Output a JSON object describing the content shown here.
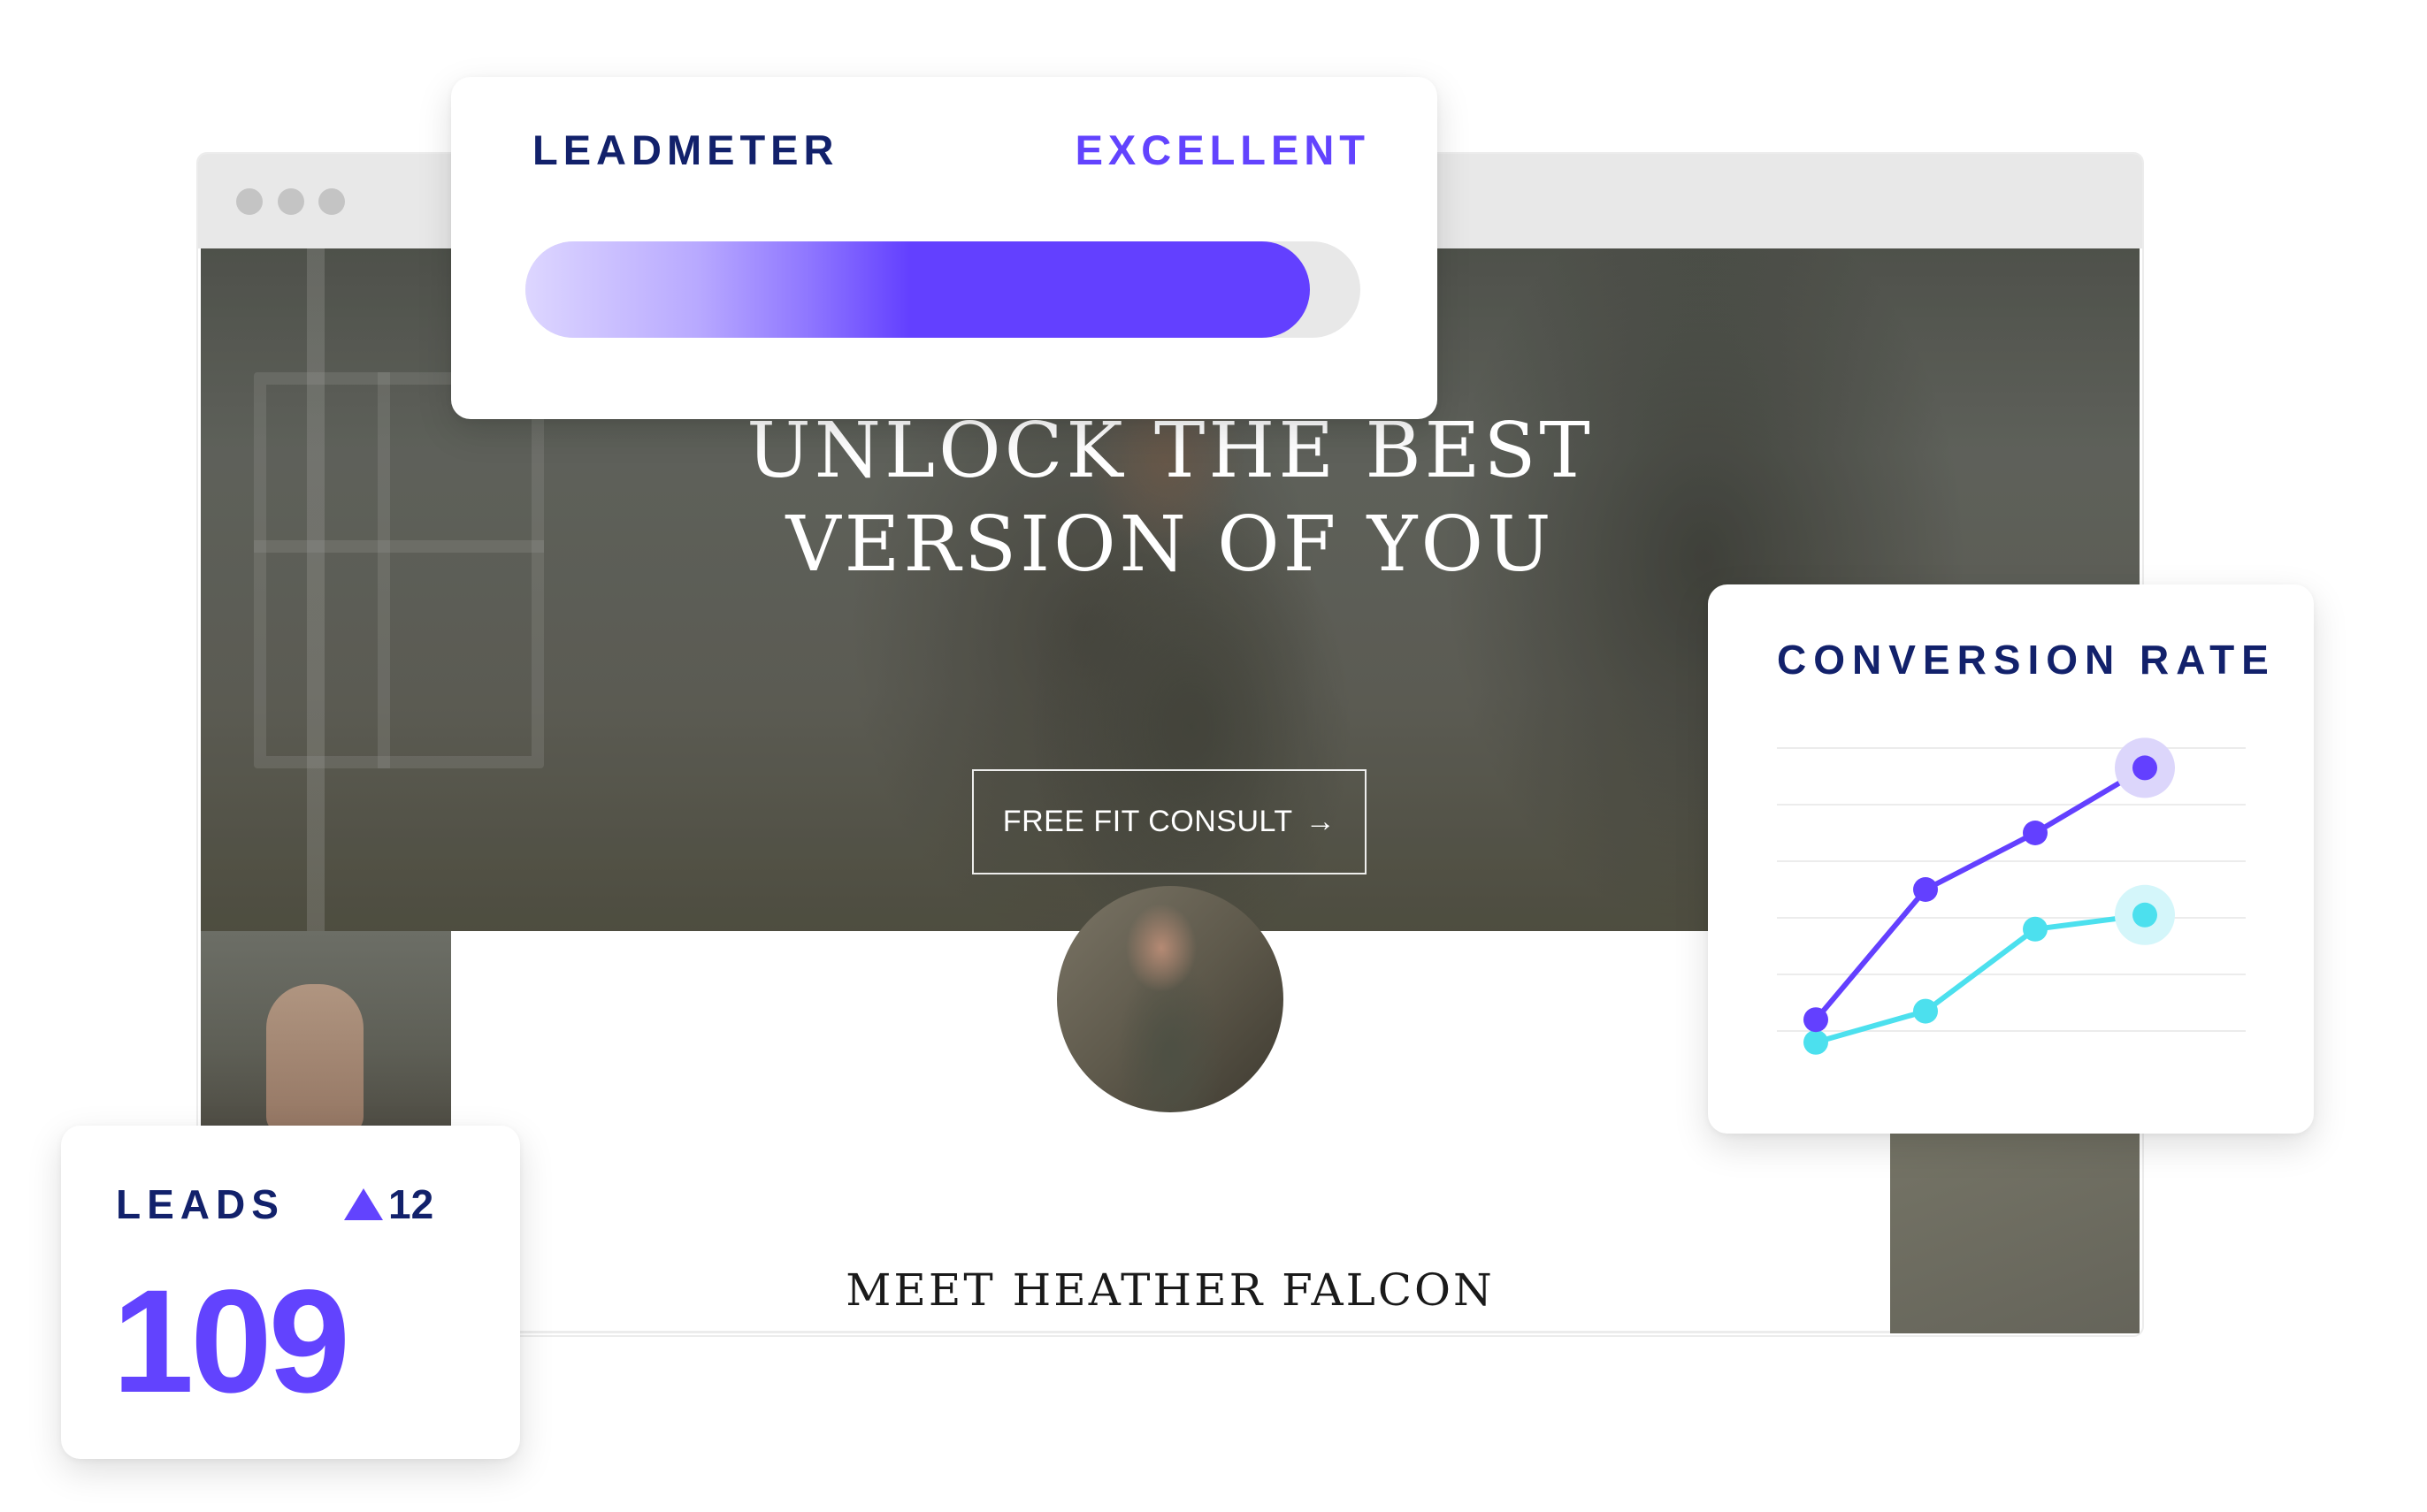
{
  "browser": {
    "window_controls": [
      "dot",
      "dot",
      "dot"
    ]
  },
  "hero": {
    "headline_line1": "UNLOCK THE BEST",
    "headline_line2": "VERSION OF YOU",
    "cta_label": "FREE FIT CONSULT",
    "cta_icon": "arrow-right-icon",
    "cta_arrow": "→"
  },
  "profile": {
    "avatar": "avatar-photo",
    "heading": "MEET HEATHER FALCON"
  },
  "leadmeter": {
    "title": "LEADMETER",
    "status": "EXCELLENT",
    "progress_percent": 94,
    "colors": {
      "accent": "#6340ff",
      "track": "#e8e8e8",
      "title": "#12216b"
    }
  },
  "leads": {
    "label": "LEADS",
    "delta_icon": "triangle-up-icon",
    "delta": "12",
    "value": "109"
  },
  "conversion": {
    "title": "CONVERSION RATE"
  },
  "chart_data": {
    "type": "line",
    "title": "CONVERSION RATE",
    "xlabel": "",
    "ylabel": "",
    "x": [
      1,
      2,
      3,
      4
    ],
    "ylim": [
      0,
      5
    ],
    "grid": true,
    "gridlines": 6,
    "legend": "none",
    "series": [
      {
        "name": "series-purple",
        "color": "#6340ff",
        "halo": "#dcd6fb",
        "values": [
          0.2,
          2.5,
          3.5,
          4.65
        ],
        "highlight_last": true
      },
      {
        "name": "series-cyan",
        "color": "#4ce0ee",
        "halo": "#d4f6fa",
        "values": [
          -0.2,
          0.35,
          1.8,
          2.05
        ],
        "highlight_last": true
      }
    ]
  }
}
